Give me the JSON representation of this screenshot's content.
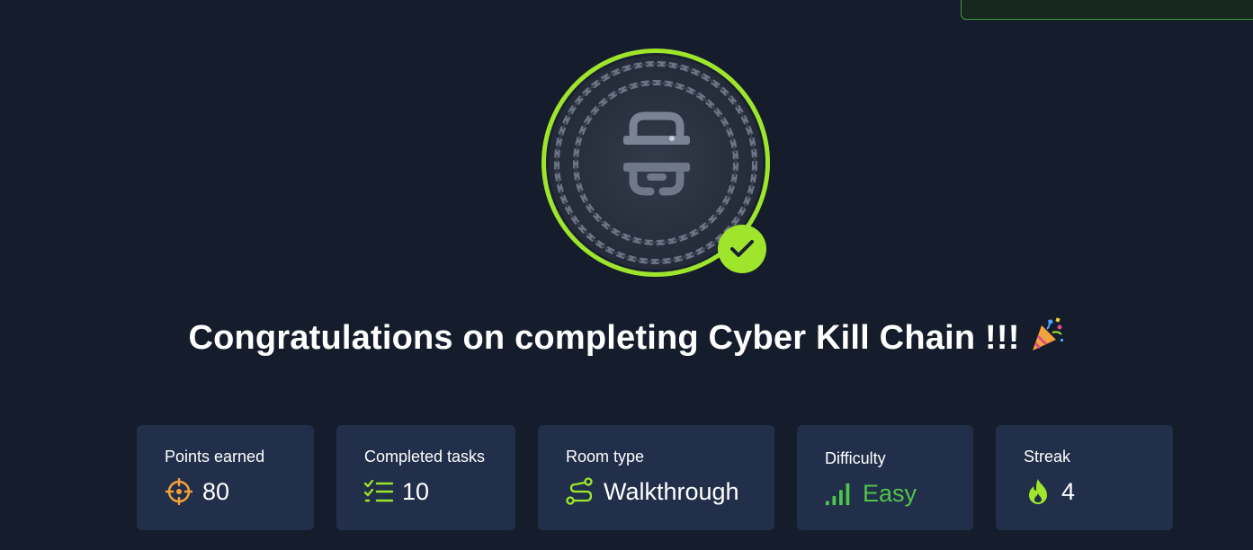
{
  "header": {
    "title": "Congratulations on completing Cyber Kill Chain !!!"
  },
  "badge": {
    "icon": "chain-link-icon",
    "completed": true,
    "ring_color": "#9ee52c"
  },
  "stats": [
    {
      "label": "Points earned",
      "value": "80",
      "icon": "crosshair-icon",
      "color": "#f5a13a"
    },
    {
      "label": "Completed tasks",
      "value": "10",
      "icon": "checklist-icon",
      "color": "#9ee52c"
    },
    {
      "label": "Room type",
      "value": "Walkthrough",
      "icon": "route-icon",
      "color": "#9ee52c"
    },
    {
      "label": "Difficulty",
      "value": "Easy",
      "icon": "signal-bars-icon",
      "color": "#4fc54a"
    },
    {
      "label": "Streak",
      "value": "4",
      "icon": "flame-icon",
      "color": "#9ee52c"
    }
  ],
  "colors": {
    "background": "#151c2b",
    "card": "#212f4a",
    "accent": "#9ee52c"
  }
}
